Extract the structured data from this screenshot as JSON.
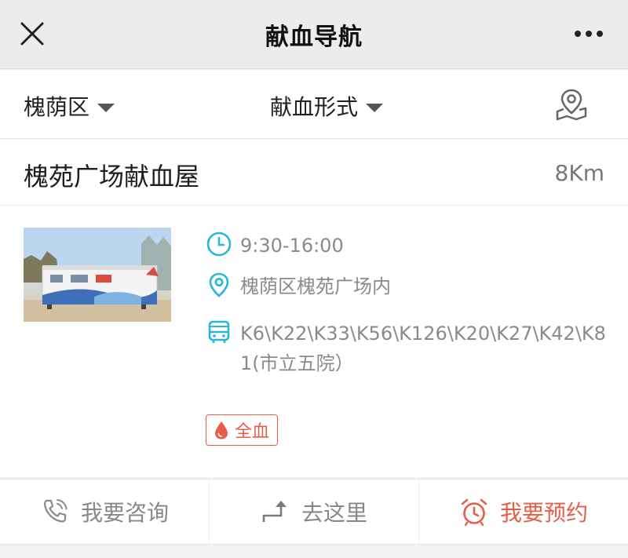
{
  "header": {
    "title": "献血导航",
    "close_icon": "close-icon",
    "more_icon": "more-icon"
  },
  "filters": {
    "district_label": "槐荫区",
    "type_label": "献血形式",
    "map_icon": "map-pin-icon"
  },
  "station": {
    "name": "槐苑广场献血屋",
    "distance": "8Km",
    "hours": "9:30-16:00",
    "address": "槐荫区槐苑广场内",
    "bus_routes": "K6\\K22\\K33\\K56\\K126\\K20\\K27\\K42\\K81(市立五院）",
    "tag": "全血",
    "icon_color": "#29b6d8",
    "accent_color": "#e85d4a"
  },
  "actions": [
    {
      "label": "我要咨询",
      "icon": "phone-icon"
    },
    {
      "label": "去这里",
      "icon": "navigate-arrow-icon"
    },
    {
      "label": "我要预约",
      "icon": "alarm-clock-icon"
    }
  ]
}
